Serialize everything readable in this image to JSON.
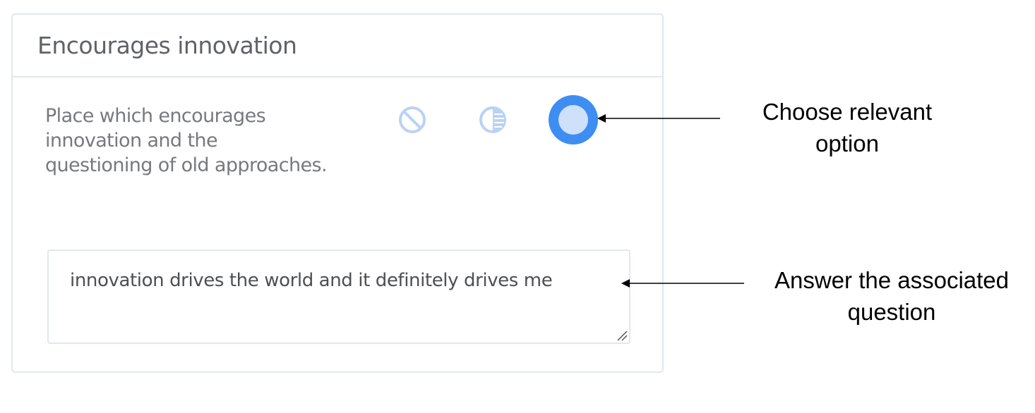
{
  "card": {
    "title": "Encourages innovation",
    "question": "Place which encourages innovation and the questioning of old approaches.",
    "options": [
      {
        "icon": "prohibited-circle-icon",
        "state": "unselected"
      },
      {
        "icon": "half-circle-icon",
        "state": "unselected"
      },
      {
        "icon": "full-circle-icon",
        "state": "selected"
      }
    ],
    "answer": {
      "value": "innovation drives the world and it definitely drives me"
    }
  },
  "annotations": {
    "options_note": {
      "line1": "Choose relevant",
      "line2": "option"
    },
    "answer_note": {
      "line1": "Answer the associated",
      "line2": "question"
    }
  },
  "colors": {
    "accent": "#3d8ef0",
    "accent_light": "#cfe0fb",
    "border": "#e1e7f0",
    "title_text": "#5f6267",
    "body_text": "#77797d"
  }
}
